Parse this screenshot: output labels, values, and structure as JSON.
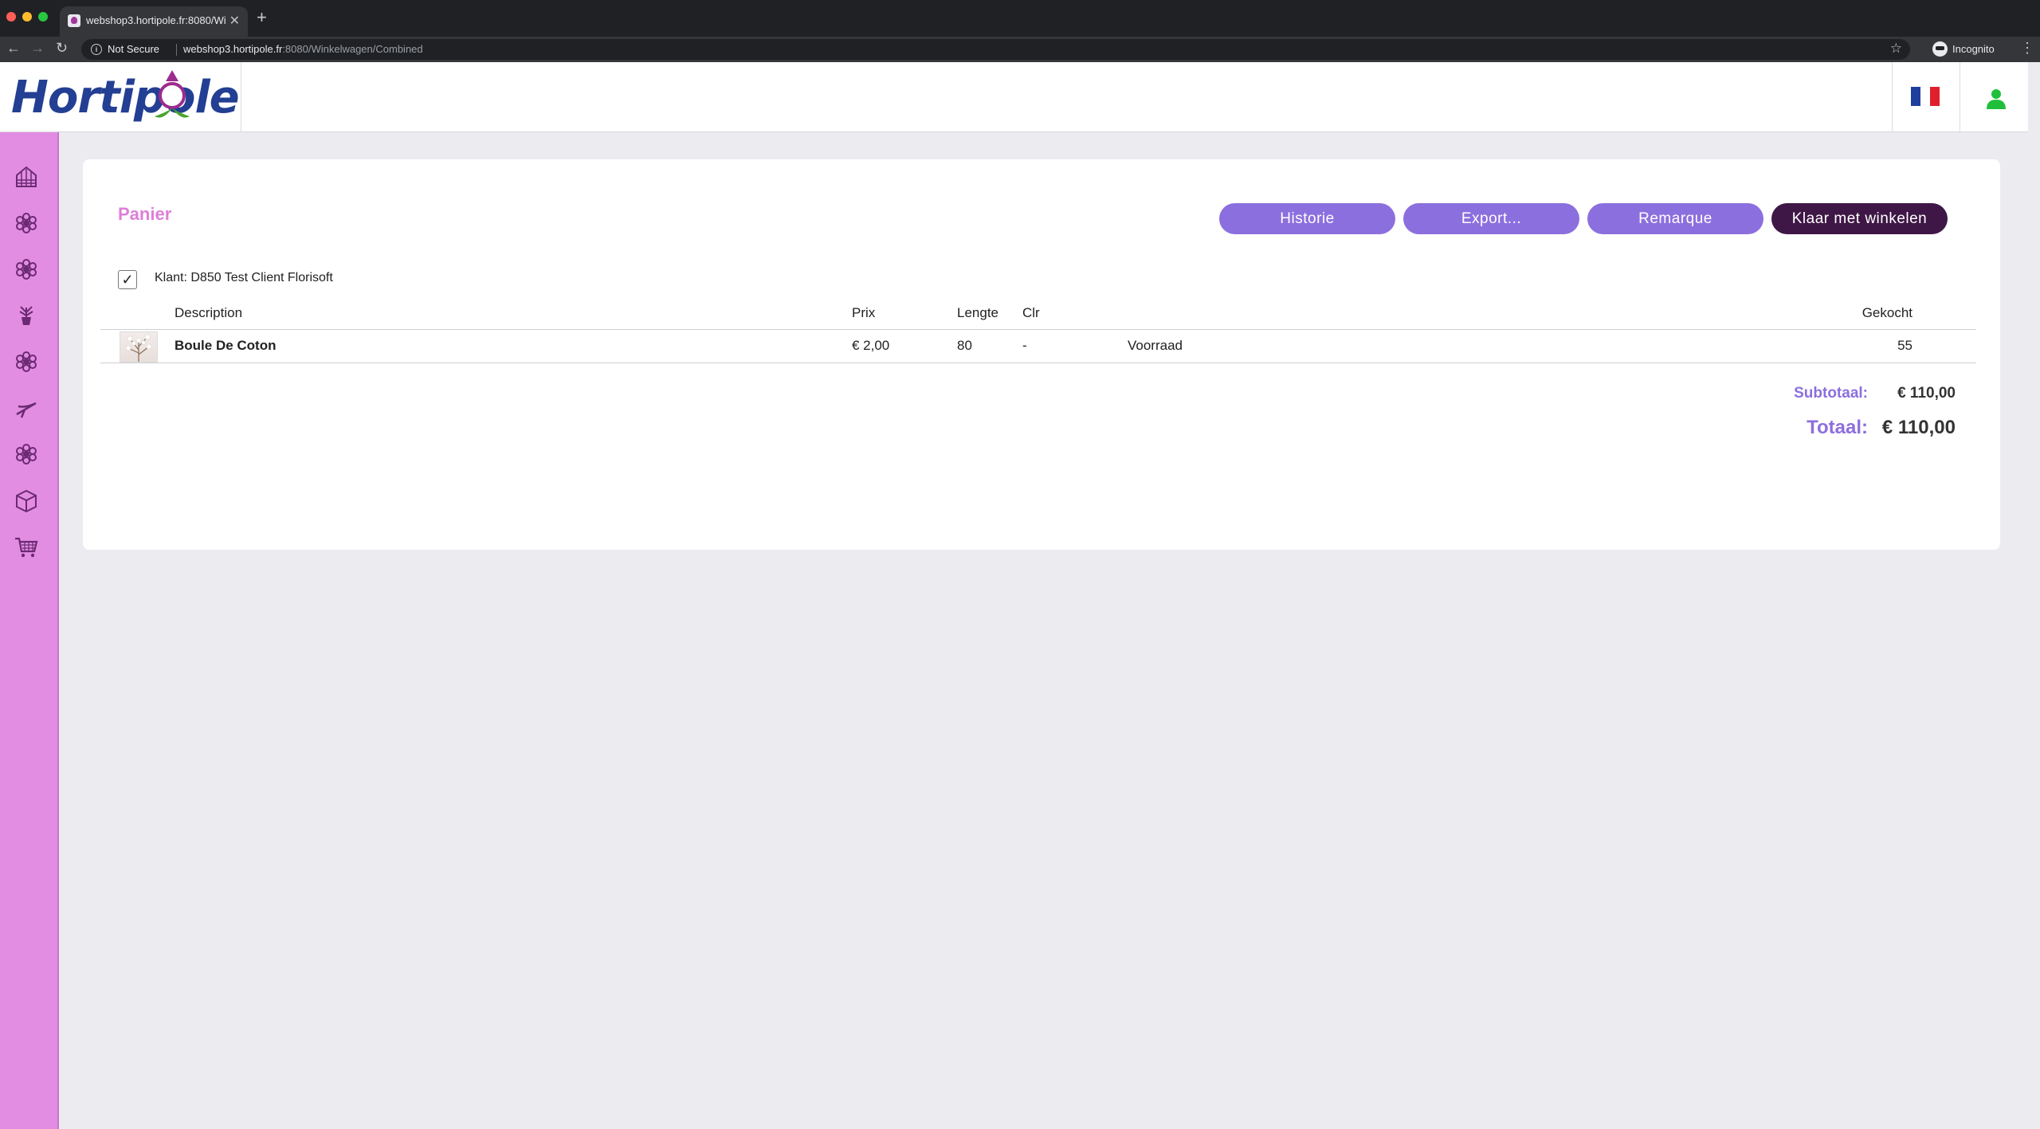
{
  "browser": {
    "tab_title": "webshop3.hortipole.fr:8080/Wi",
    "security_label": "Not Secure",
    "url_host": "webshop3.hortipole.fr",
    "url_rest": ":8080/Winkelwagen/Combined",
    "incognito_label": "Incognito"
  },
  "header": {
    "logo_text": "Hortipole",
    "language_flag": "fr",
    "flag_colors": [
      "#1f3f9e",
      "#ffffff",
      "#e0202b"
    ],
    "user_icon_color": "#1fbf3a"
  },
  "sidebar": {
    "background": "#e38de2",
    "icons": [
      "greenhouse-icon",
      "flower-icon",
      "flower-icon",
      "potted-plant-icon",
      "flower-icon",
      "pruning-shears-icon",
      "flower-icon",
      "box-icon",
      "cart-icon"
    ]
  },
  "cart": {
    "title": "Panier",
    "buttons": {
      "history": "Historie",
      "export": "Export...",
      "remark": "Remarque",
      "done": "Klaar met winkelen"
    },
    "client_checked": true,
    "client_label": "Klant: D850 Test Client Florisoft",
    "columns": {
      "description": "Description",
      "price": "Prix",
      "length": "Lengte",
      "color": "Clr",
      "bought": "Gekocht"
    },
    "rows": [
      {
        "description": "Boule De Coton",
        "price": "€ 2,00",
        "length": "80",
        "color": "-",
        "stock": "Voorraad",
        "bought": "55"
      }
    ],
    "subtotal_label": "Subtotaal:",
    "subtotal_value": "€ 110,00",
    "total_label": "Totaal:",
    "total_value": "€ 110,00"
  },
  "colors": {
    "accent_purple": "#8c6fde",
    "dark_button": "#3f1746",
    "title_pink": "#de7ed9",
    "page_bg": "#ecebf0"
  }
}
